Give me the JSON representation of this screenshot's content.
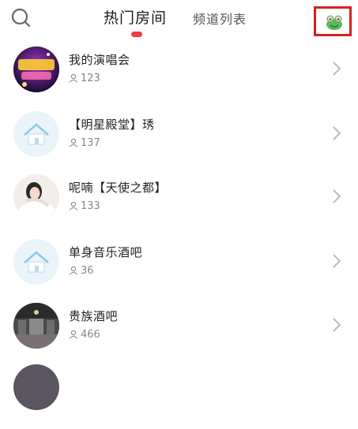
{
  "header": {
    "tabs": [
      {
        "label": "热门房间",
        "active": true
      },
      {
        "label": "频道列表",
        "active": false
      }
    ],
    "search_icon": "search-icon",
    "avatar_icon": "frog-avatar-icon",
    "accent_color": "#f23b3b",
    "highlight_border_color": "#d8201e"
  },
  "rooms": [
    {
      "name": "我的演唱会",
      "listeners": "123",
      "thumb": "concert-poster"
    },
    {
      "name": "【明星殿堂】琇",
      "listeners": "137",
      "thumb": "house-placeholder-icon"
    },
    {
      "name": "呢喃【天使之都】",
      "listeners": "133",
      "thumb": "person-photo"
    },
    {
      "name": "单身音乐酒吧",
      "listeners": "36",
      "thumb": "house-placeholder-icon"
    },
    {
      "name": "贵族酒吧",
      "listeners": "466",
      "thumb": "bar-photo"
    }
  ]
}
